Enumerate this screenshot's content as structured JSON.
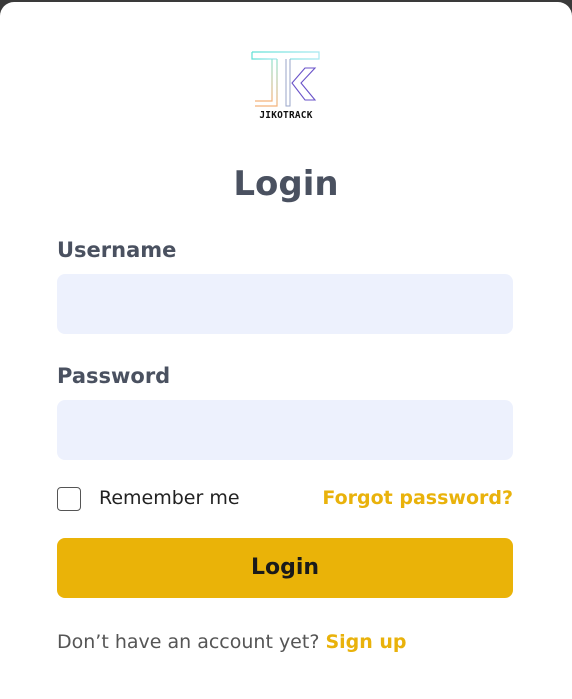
{
  "brand": {
    "name": "JIKOTRACK",
    "colors": {
      "accent": "#eab308",
      "heading": "#4a5160",
      "input_bg": "#edf1fd",
      "link": "#e9b20b"
    }
  },
  "form": {
    "title": "Login",
    "username_label": "Username",
    "username_value": "",
    "password_label": "Password",
    "password_value": "",
    "remember_label": "Remember me",
    "remember_checked": false,
    "forgot_label": "Forgot password?",
    "submit_label": "Login"
  },
  "footer": {
    "prompt": "Don’t have an account yet? ",
    "signup_label": "Sign up"
  },
  "icons": {
    "logo": "jikotrack-logo-icon",
    "checkbox": "checkbox-icon"
  }
}
